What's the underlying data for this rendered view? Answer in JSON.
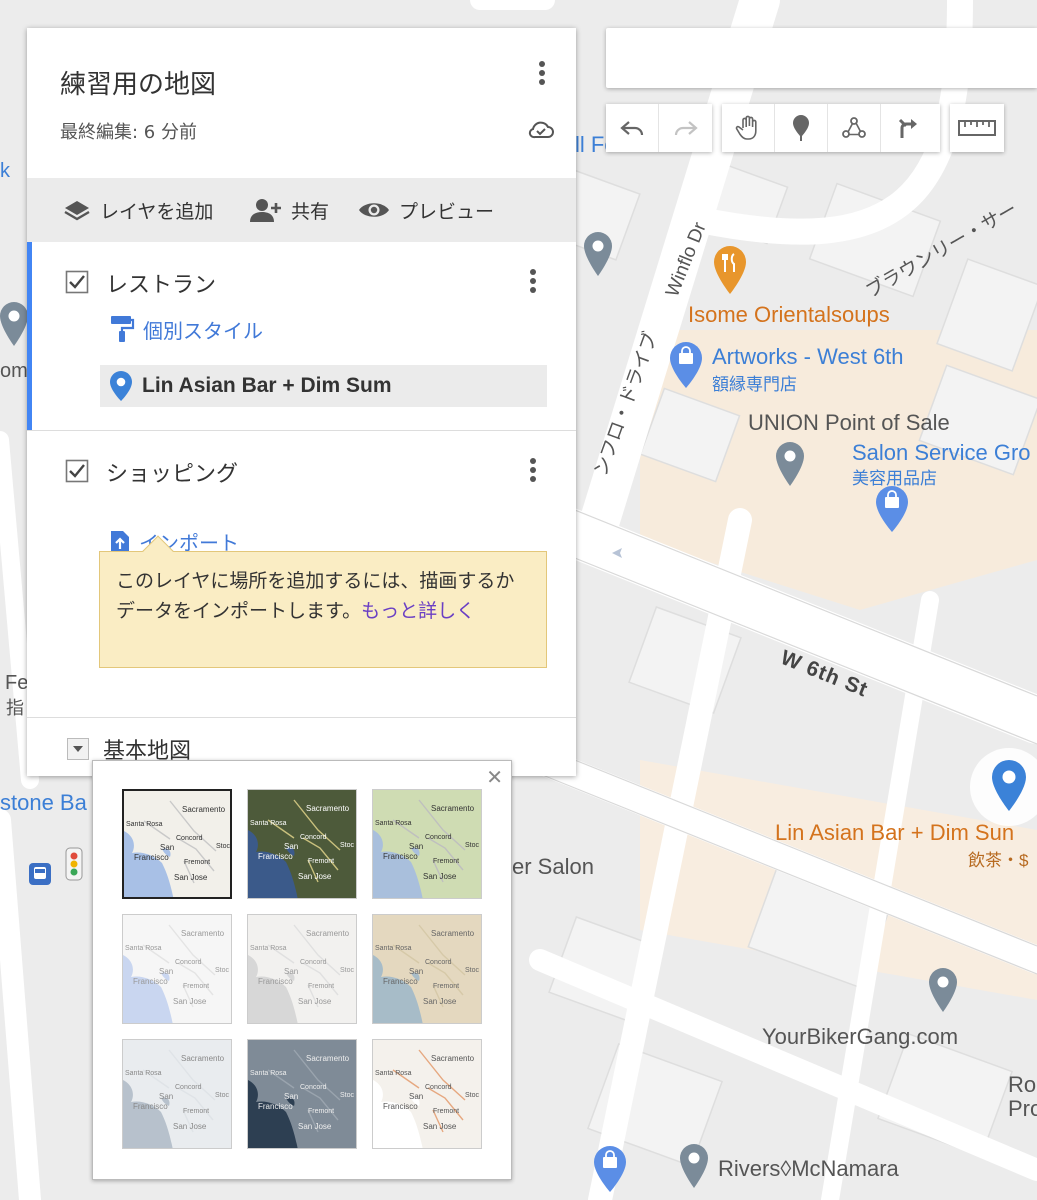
{
  "map": {
    "title": "練習用の地図",
    "last_edited": "最終編集: 6 分前"
  },
  "actions": {
    "add_layer": "レイヤを追加",
    "share": "共有",
    "preview": "プレビュー"
  },
  "layers": [
    {
      "name": "レストラン",
      "checked": true,
      "style_link": "個別スタイル",
      "places": [
        "Lin Asian Bar + Dim Sum"
      ]
    },
    {
      "name": "ショッピング",
      "checked": true,
      "import_link": "インポート",
      "tooltip": {
        "text": "このレイヤに場所を追加するには、描画するかデータをインポートします。",
        "link": "もっと詳しく"
      }
    }
  ],
  "basemap": {
    "label": "基本地図",
    "options": [
      {
        "style": "map",
        "selected": true
      },
      {
        "style": "satellite",
        "selected": false
      },
      {
        "style": "terrain",
        "selected": false
      },
      {
        "style": "light-political",
        "selected": false
      },
      {
        "style": "mono-city",
        "selected": false
      },
      {
        "style": "simple-atlas",
        "selected": false
      },
      {
        "style": "light-landmass",
        "selected": false
      },
      {
        "style": "dark-landmass",
        "selected": false
      },
      {
        "style": "whitewater",
        "selected": false
      }
    ],
    "thumb_labels": {
      "sacramento": "Sacramento",
      "santa_rosa": "Santa Rosa",
      "concord": "Concord",
      "san": "San",
      "francisco": "Francisco",
      "fremont": "Fremont",
      "san_jose": "San Jose",
      "stockton": "Stoc"
    }
  },
  "toolbar": {
    "tools": [
      "undo-icon",
      "redo-icon",
      "hand-icon",
      "marker-icon",
      "line-icon",
      "directions-icon",
      "ruler-icon"
    ]
  },
  "map_labels": {
    "isome": "Isome Orientalsoups",
    "artworks": "Artworks - West 6th",
    "artworks_sub": "額縁専門店",
    "union": "UNION Point of Sale",
    "salon_service": "Salon Service Gro",
    "salon_sub": "美容用品店",
    "w6th": "W 6th St",
    "lin": "Lin Asian Bar + Dim Sun",
    "lin_sub": "飲茶・$",
    "yourbiker": "YourBikerGang.com",
    "rivers": "Rivers◊McNamara",
    "winflo": "Winflo Dr",
    "winflo_jp": "ンフロ・ドライブ",
    "brownlee": "ブラウンリー・サー",
    "er_salon": "er Salon",
    "stone_ba": "stone Ba",
    "foundation": "ll Foundation",
    "ro": "Ro",
    "pro": "Pro",
    "fe": "Fe",
    "zhi": "指",
    "om": "om",
    "k": "k"
  },
  "colors": {
    "accent_blue": "#4285f4",
    "link_blue": "#4179d8",
    "poi_orange": "#e8962c",
    "tooltip_bg": "#faedc4"
  }
}
